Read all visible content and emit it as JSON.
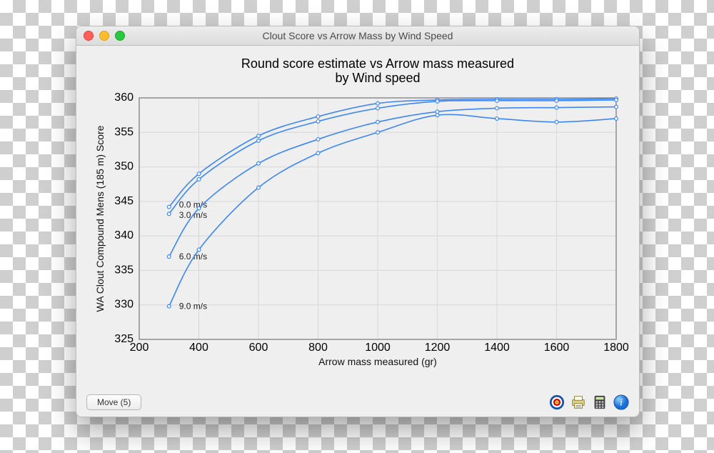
{
  "window": {
    "title": "Clout Score vs Arrow Mass by Wind Speed"
  },
  "footer": {
    "move_button": "Move (5)"
  },
  "icons": {
    "target": "target-icon",
    "print": "print-icon",
    "calc": "calculator-icon",
    "info": "info-icon"
  },
  "chart_data": {
    "type": "line",
    "title": "Round score estimate vs Arrow mass measured\nby Wind speed",
    "xlabel": "Arrow mass measured (gr)",
    "ylabel": "WA Clout Compound Mens (185 m) Score",
    "xlim": [
      200,
      1800
    ],
    "ylim": [
      325,
      360
    ],
    "x_ticks": [
      200,
      400,
      600,
      800,
      1000,
      1200,
      1400,
      1600,
      1800
    ],
    "y_ticks": [
      325,
      330,
      335,
      340,
      345,
      350,
      355,
      360
    ],
    "x": [
      300,
      400,
      600,
      800,
      1000,
      1200,
      1400,
      1600,
      1800
    ],
    "series": [
      {
        "name": "0.0 m/s",
        "values": [
          344.2,
          349.0,
          354.5,
          357.3,
          359.2,
          359.7,
          359.8,
          359.8,
          359.9
        ]
      },
      {
        "name": "3.0 m/s",
        "values": [
          343.2,
          348.2,
          353.8,
          356.6,
          358.5,
          359.5,
          359.6,
          359.6,
          359.7
        ]
      },
      {
        "name": "6.0 m/s",
        "values": [
          337.0,
          344.0,
          350.5,
          354.0,
          356.5,
          358.0,
          358.5,
          358.6,
          358.7
        ]
      },
      {
        "name": "9.0 m/s",
        "values": [
          329.8,
          338.0,
          347.0,
          352.0,
          355.0,
          357.5,
          357.0,
          356.5,
          357.0
        ]
      }
    ],
    "series_label_y": {
      "0.0 m/s": 344.5,
      "3.0 m/s": 343.0,
      "6.0 m/s": 337.0,
      "9.0 m/s": 329.8
    }
  }
}
